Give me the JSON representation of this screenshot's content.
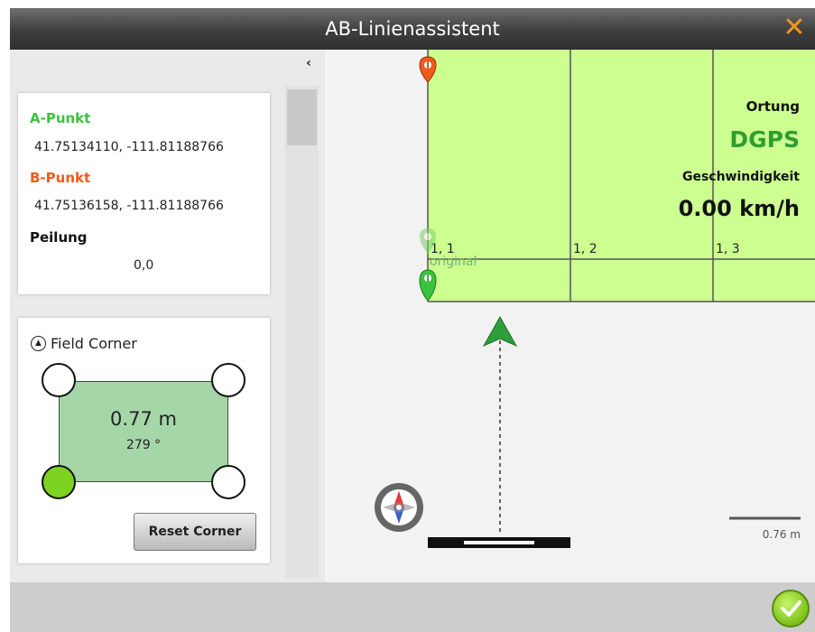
{
  "window": {
    "title": "AB-Linienassistent",
    "close_glyph": "✕"
  },
  "points": {
    "a_label": "A-Punkt",
    "a_value": "41.75134110, -111.81188766",
    "b_label": "B-Punkt",
    "b_value": "41.75136158, -111.81188766",
    "bearing_label": "Peilung",
    "bearing_value": "0,0"
  },
  "field_corner": {
    "title": "Field Corner",
    "distance": "0.77 m",
    "angle": "279 °",
    "reset_label": "Reset Corner",
    "selected_corner": "bottom-left"
  },
  "map": {
    "location_label": "Ortung",
    "location_value": "DGPS",
    "speed_label": "Geschwindigkeit",
    "speed_value": "0.00 km/h",
    "cells": [
      "1, 1",
      "1, 2",
      "1, 3"
    ],
    "original_label": "original",
    "scale_label": "0.76 m"
  },
  "colors": {
    "field_fill": "#ccff90",
    "a_point": "#3cc33c",
    "b_point": "#f25a1c",
    "accent": "#f7941d",
    "dgps": "#2e9e2e"
  },
  "icons": {
    "close": "close-icon",
    "collapse": "chevron-left-icon",
    "compass": "compass-icon",
    "confirm": "checkmark-icon"
  }
}
